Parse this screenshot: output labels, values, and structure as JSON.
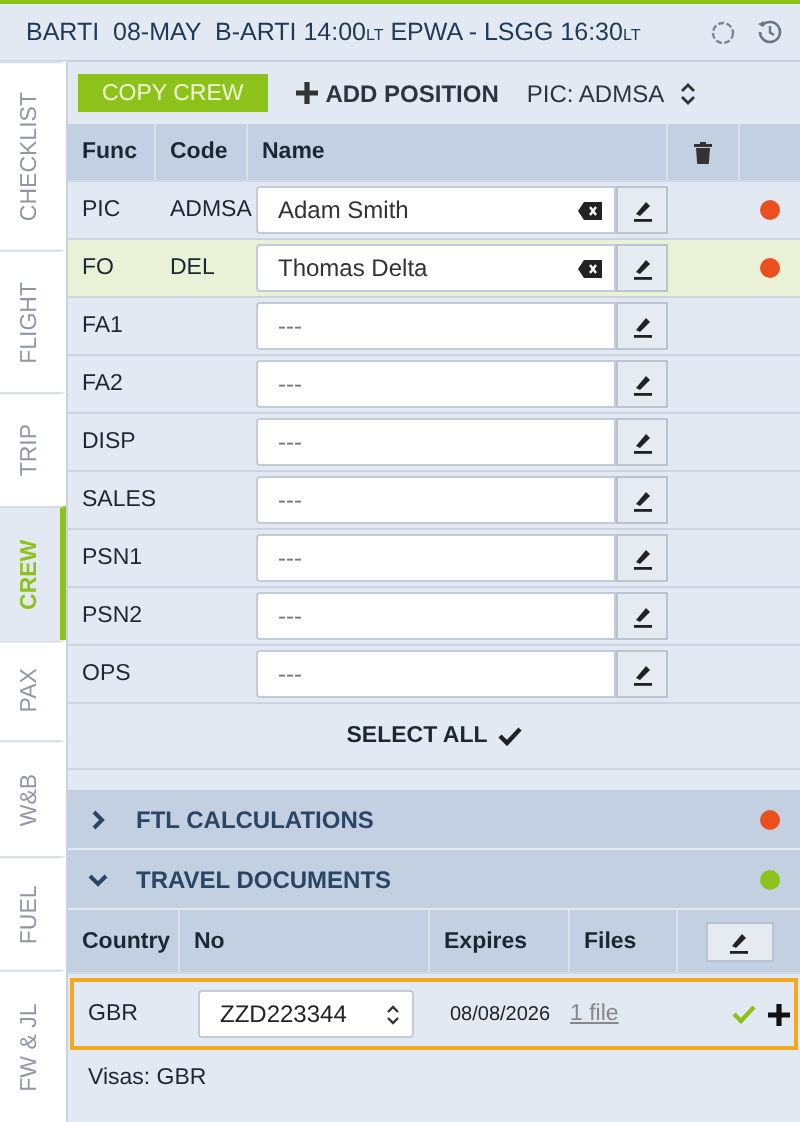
{
  "header": {
    "title": "BARTI  08-MAY  B-ARTI 14:00$_{LT}$ EPWA - LSGG 16:30$_{LT}$"
  },
  "side_tabs": [
    {
      "label": "CHECKLIST",
      "selected": false
    },
    {
      "label": "FLIGHT",
      "selected": false
    },
    {
      "label": "TRIP",
      "selected": false
    },
    {
      "label": "CREW",
      "selected": true
    },
    {
      "label": "PAX",
      "selected": false
    },
    {
      "label": "W&B",
      "selected": false
    },
    {
      "label": "FUEL",
      "selected": false
    },
    {
      "label": "FW & JL",
      "selected": false
    }
  ],
  "toolbar": {
    "copy_button": "COPY CREW",
    "add_button": "ADD POSITION",
    "pic_select": "PIC: ADMSA"
  },
  "crew_table": {
    "columns": [
      "Func",
      "Code",
      "Name"
    ],
    "rows": [
      {
        "func": "PIC",
        "code": "ADMSA",
        "name": "Adam Smith",
        "selected": false,
        "color": "#e9501e"
      },
      {
        "func": "FO",
        "code": "DEL",
        "name": "Thomas Delta",
        "selected": true,
        "color": "#e9501e"
      },
      {
        "func": "FA1",
        "placeholder": "---",
        "selected": false
      },
      {
        "func": "FA2",
        "placeholder": "---",
        "selected": false
      },
      {
        "func": "DISP",
        "placeholder": "---",
        "selected": false
      },
      {
        "func": "SALES",
        "placeholder": "---",
        "selected": false
      },
      {
        "func": "PSN1",
        "placeholder": "---",
        "selected": false
      },
      {
        "func": "PSN2",
        "placeholder": "---",
        "selected": false
      },
      {
        "func": "OPS",
        "placeholder": "---",
        "selected": false
      }
    ]
  },
  "select_all": "SELECT ALL",
  "sections": [
    {
      "title": "FTL CALCULATIONS",
      "expanded": false,
      "color": "#e9501e"
    },
    {
      "title": "TRAVEL DOCUMENTS",
      "expanded": true,
      "color": "#8cc21a"
    }
  ],
  "documents": {
    "columns": [
      "Country",
      "No",
      "Expires",
      "Files"
    ],
    "rows": [
      {
        "country": "GBR",
        "number": "ZZD223344",
        "expires": "08/08/2026",
        "files": "1 file",
        "valid": true
      }
    ],
    "visas": "Visas: GBR"
  }
}
